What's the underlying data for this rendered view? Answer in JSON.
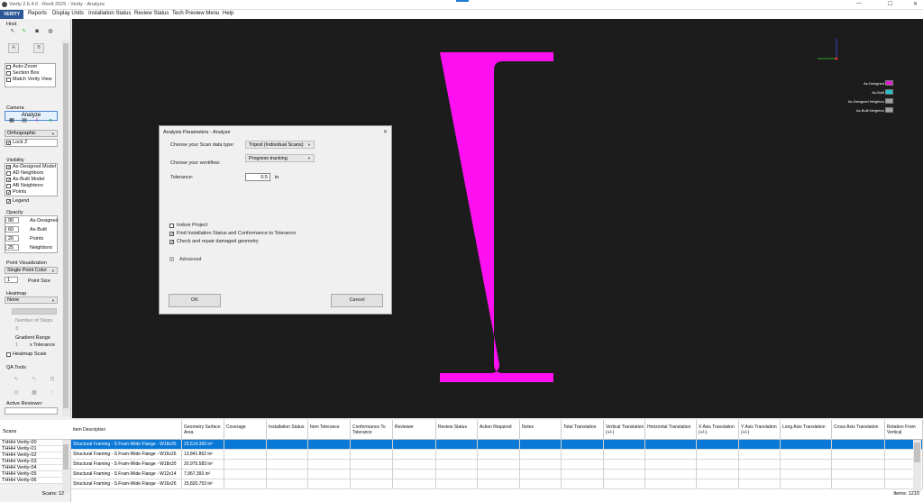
{
  "titlebar": {
    "title": "Verity 2.6.4.0 - Revit 2025 - Verity - Analyze",
    "min": "—",
    "max": "☐",
    "close": "✕"
  },
  "menu": {
    "logo": "VERITY",
    "items": [
      "Reports",
      "Display Units",
      "Installation Status",
      "Review Status",
      "Tech Preview Menu",
      "Help"
    ]
  },
  "left": {
    "host_title": "Host",
    "host_icons": [
      "cursor-icon",
      "cursor-green-icon",
      "camera-icon",
      "globe-icon"
    ],
    "host_btn_a": "A",
    "host_btn_b": "B",
    "checks": [
      {
        "label": "Auto-Zoom",
        "checked": false
      },
      {
        "label": "Section Box",
        "checked": false
      },
      {
        "label": "Match Verity View",
        "checked": false
      }
    ],
    "analyze_label": "Analyze",
    "camera_title": "Camera",
    "projection": "Orthographic",
    "lock_z": "Lock Z",
    "visibility_title": "Visibility",
    "visibility": [
      {
        "label": "As-Designed Model",
        "checked": true
      },
      {
        "label": "AD Neighbors",
        "checked": false
      },
      {
        "label": "As-Built Model",
        "checked": true
      },
      {
        "label": "AB Neighbors",
        "checked": false
      },
      {
        "label": "Points",
        "checked": true
      }
    ],
    "legend": "Legend",
    "opacity_title": "Opacity",
    "opacity": [
      {
        "value": "90",
        "label": "As-Designed"
      },
      {
        "value": "60",
        "label": "As-Built"
      },
      {
        "value": "20",
        "label": "Points"
      },
      {
        "value": "25",
        "label": "Neighbors"
      }
    ],
    "pv_title": "Point Visualization",
    "pv_value": "Single Point Color",
    "point_size_value": "1",
    "point_size_label": "Point Size",
    "heatmap_title": "Heatmap",
    "heatmap_value": "None",
    "num_steps_label": "Number of Steps",
    "num_steps_value": "3",
    "gradient_label": "Gradient Range",
    "gradient_value": "1",
    "tolerance_label": "x Tolerance",
    "heatmap_scale": "Heatmap Scale",
    "qa_title": "QA Tools",
    "active_reviewer": "Active Reviewer"
  },
  "legend_items": [
    {
      "label": "As-Designed",
      "color": "#e020d0"
    },
    {
      "label": "As-Built",
      "color": "#20c0c8"
    },
    {
      "label": "As-Designed Neighbor",
      "color": "#a0a0a0"
    },
    {
      "label": "As-Built Neighbor",
      "color": "#a0a0a0"
    }
  ],
  "beam_color": "#ff10f0",
  "dialog": {
    "title": "Analysis Parameters - Analyze",
    "scan_type_label": "Choose your Scan data type:",
    "scan_type_value": "Tripod (Individual Scans)",
    "workflow_label": "Choose your workflow:",
    "workflow_value": "Progress tracking",
    "tolerance_label": "Tolerance:",
    "tolerance_value": "0.5",
    "tolerance_unit": "in",
    "options": [
      {
        "label": "Indoor Project",
        "checked": false
      },
      {
        "label": "Find Installation Status and Conformance to Tolerance",
        "checked": true
      },
      {
        "label": "Check and repair damaged geometry",
        "checked": true
      }
    ],
    "advanced": "Advanced",
    "ok": "OK",
    "cancel": "Cancel"
  },
  "scans": {
    "title": "Scans",
    "items": [
      "THHH Verity-00",
      "THHH Verity-01",
      "THHH Verity-02",
      "THHH Verity-03",
      "THHH Verity-04",
      "THHH Verity-05",
      "THHH Verity-06"
    ],
    "count": "Scans: 12"
  },
  "table": {
    "columns": [
      "Item Description",
      "Geometry Surface Area",
      "Coverage",
      "Installation Status",
      "Item Tolerance",
      "Conformance To Tolerance",
      "Reviewer",
      "Review Status",
      "Action Required",
      "Notes",
      "Total Translation",
      "Vertical Translation (+/-)",
      "Horizontal Translation",
      "X Axis Translation (+/-)",
      "Y Axis Translation (+/-)",
      "Long Axis Translation",
      "Cross Axis Translation",
      "Rotation From Vertical"
    ],
    "rows": [
      {
        "desc": "Structural Framing - S Fram-Wide Flange - W18x35",
        "area": "23,614.366 in²"
      },
      {
        "desc": "Structural Framing - S Fram-Wide Flange - W16x26",
        "area": "13,841.862 in²"
      },
      {
        "desc": "Structural Framing - S Fram-Wide Flange - W18x35",
        "area": "20,975.583 in²"
      },
      {
        "desc": "Structural Framing - S Fram-Wide Flange - W12x14",
        "area": "7,967.393 in²"
      },
      {
        "desc": "Structural Framing - S Fram-Wide Flange - W16x26",
        "area": "15,820.753 in²"
      }
    ],
    "items_count": "Items: 1210"
  }
}
